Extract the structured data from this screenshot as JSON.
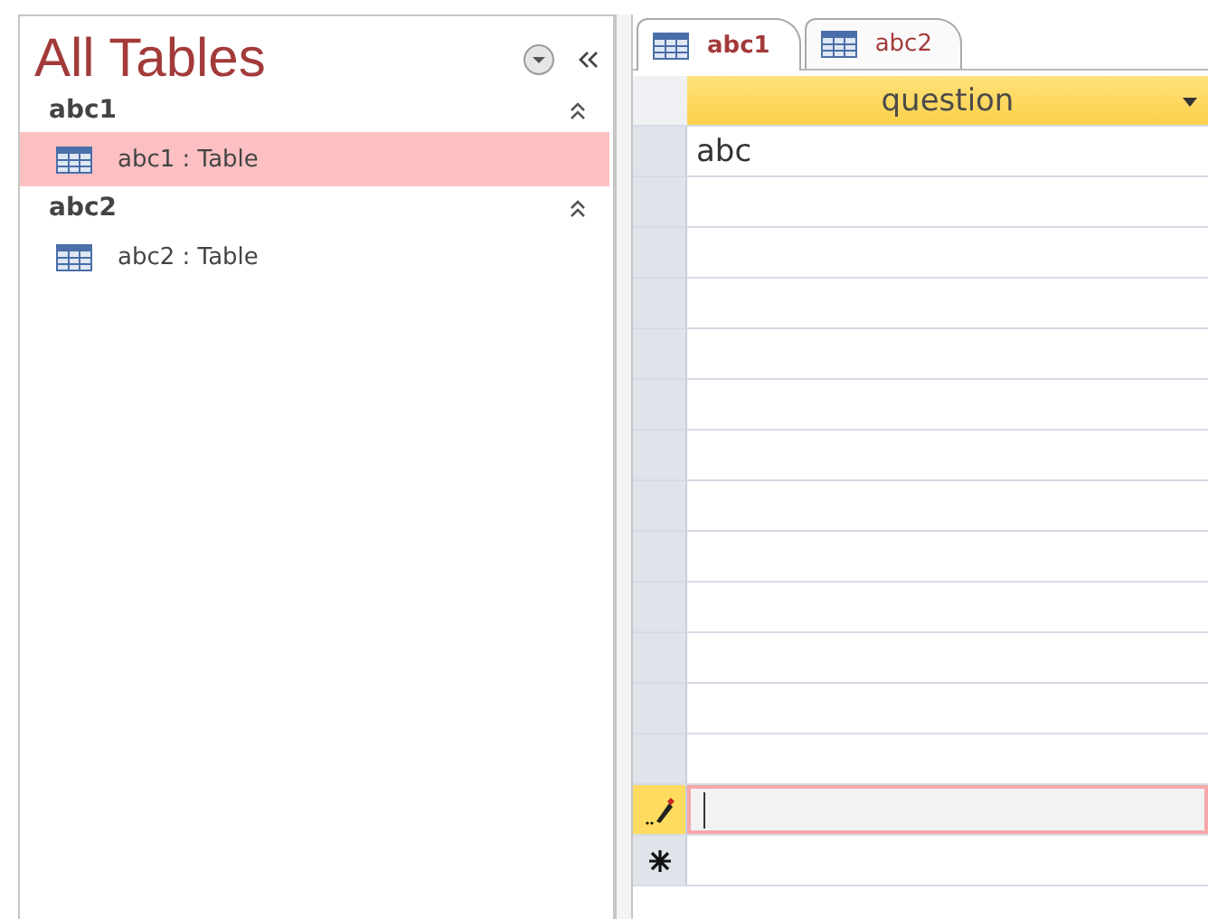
{
  "nav_pane": {
    "title": "All Tables",
    "groups": [
      {
        "name": "abc1",
        "expanded": true,
        "items": [
          {
            "label": "abc1 : Table",
            "selected": true
          }
        ]
      },
      {
        "name": "abc2",
        "expanded": true,
        "items": [
          {
            "label": "abc2 : Table",
            "selected": false
          }
        ]
      }
    ]
  },
  "tabs": [
    {
      "label": "abc1",
      "selected": true
    },
    {
      "label": "abc2",
      "selected": false
    }
  ],
  "datasheet": {
    "columns": [
      "question"
    ],
    "rows": [
      {
        "kind": "record",
        "cells": [
          "abc"
        ]
      },
      {
        "kind": "editing",
        "cells": []
      },
      {
        "kind": "new",
        "cells": []
      }
    ]
  }
}
